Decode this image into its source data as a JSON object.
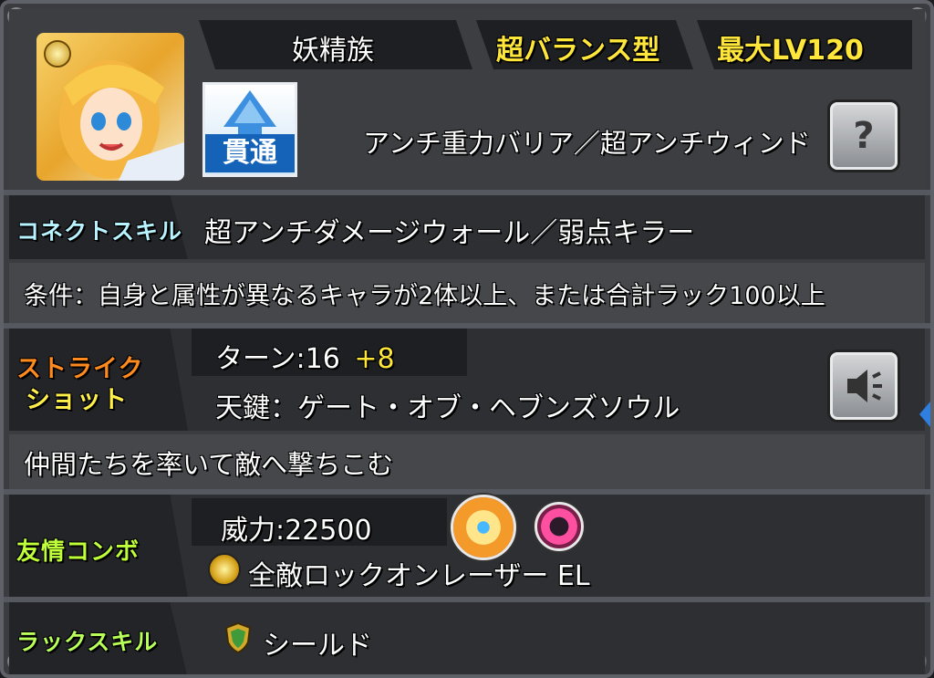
{
  "header": {
    "race": "妖精族",
    "type": "超バランス型",
    "max_level": "最大LV120"
  },
  "ability": {
    "gimmick": "アンチ重力バリア／超アンチウィンド",
    "attack_type_badge": "貫通"
  },
  "connect_skill": {
    "label": "コネクトスキル",
    "name": "超アンチダメージウォール／弱点キラー",
    "condition": "条件：自身と属性が異なるキャラが2体以上、または合計ラック100以上"
  },
  "strike_shot": {
    "label_line1": "ストライク",
    "label_line2": "ショット",
    "turns_prefix": "ターン:16",
    "turns_bonus": "+8",
    "name": "天鍵：ゲート・オブ・ヘブンズソウル",
    "description": "仲間たちを率いて敵へ撃ちこむ"
  },
  "friend_combo": {
    "label": "友情コンボ",
    "power": "威力:22500",
    "name": "全敵ロックオンレーザー EL"
  },
  "luck_skill": {
    "label": "ラックスキル",
    "name": "シールド"
  },
  "colors": {
    "frame": "#3b3c40",
    "highlight_yellow": "#ffe63b",
    "connect_label": "#b8f4ff",
    "strike_label": "#ff8a1e",
    "friend_label": "#bfff3a",
    "luck_label": "#b8ff5a"
  },
  "icons": [
    "light-element-icon",
    "pierce-badge-icon",
    "help-icon",
    "voice-icon",
    "sun-wheel-icon",
    "ring-icon",
    "shield-icon"
  ]
}
